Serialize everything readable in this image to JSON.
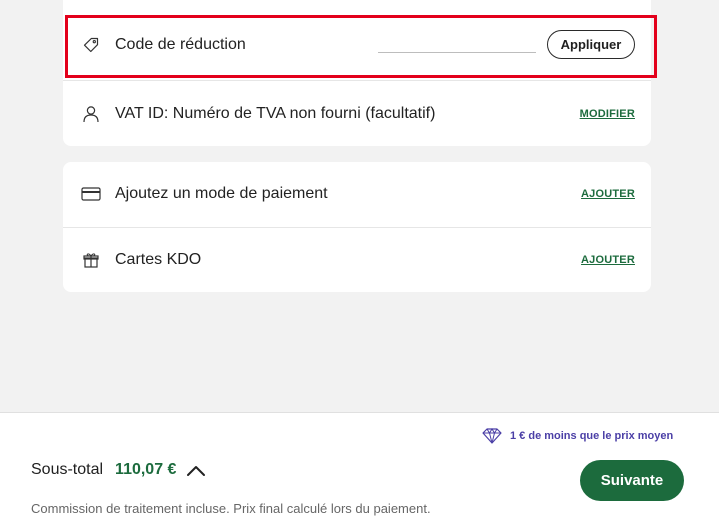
{
  "coupon": {
    "label": "Code de réduction",
    "input_value": "",
    "apply_label": "Appliquer"
  },
  "vat": {
    "label": "VAT ID: Numéro de TVA non fourni (facultatif)",
    "action": "MODIFIER"
  },
  "payment": {
    "label": "Ajoutez un mode de paiement",
    "action": "AJOUTER"
  },
  "gift_cards": {
    "label": "Cartes KDO",
    "action": "AJOUTER"
  },
  "footer": {
    "promo_text": "1 € de moins que le prix moyen",
    "subtotal_label": "Sous-total",
    "subtotal_value": "110,07 €",
    "note": "Commission de traitement incluse. Prix final calculé lors du paiement.",
    "next_label": "Suivante"
  },
  "colors": {
    "accent_green": "#1c6b3d",
    "promo_purple": "#4b3fa6",
    "highlight_red": "#e3001b"
  },
  "icons": {
    "coupon": "tag-icon",
    "vat": "user-icon",
    "payment": "credit-card-icon",
    "gift": "gift-icon",
    "promo": "diamond-icon",
    "toggle": "chevron-up-icon"
  }
}
